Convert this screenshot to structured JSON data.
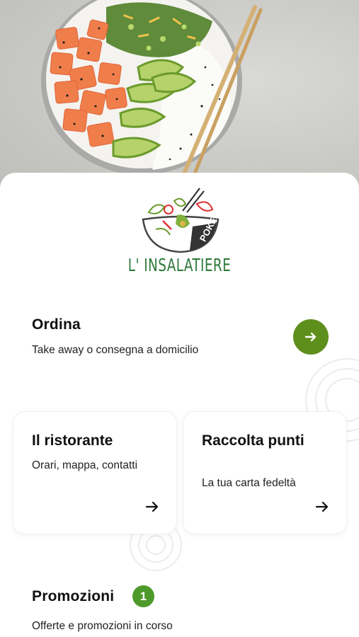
{
  "brand": {
    "name": "L' INSALATIERE",
    "logo_mark": "POKE"
  },
  "order": {
    "title": "Ordina",
    "subtitle": "Take away o consegna a domicilio",
    "button_icon": "arrow-right-icon"
  },
  "cards": [
    {
      "title": "Il ristorante",
      "subtitle": "Orari, mappa, contatti",
      "icon": "arrow-right-icon"
    },
    {
      "title": "Raccolta punti",
      "subtitle": "La tua carta fedeltà",
      "icon": "arrow-right-icon"
    }
  ],
  "promotions": {
    "title": "Promozioni",
    "count": "1",
    "subtitle": "Offerte e promozioni in corso"
  },
  "colors": {
    "accent_green": "#5e8f1c",
    "badge_green": "#4d9a2a",
    "brand_green": "#2d7a3a"
  }
}
